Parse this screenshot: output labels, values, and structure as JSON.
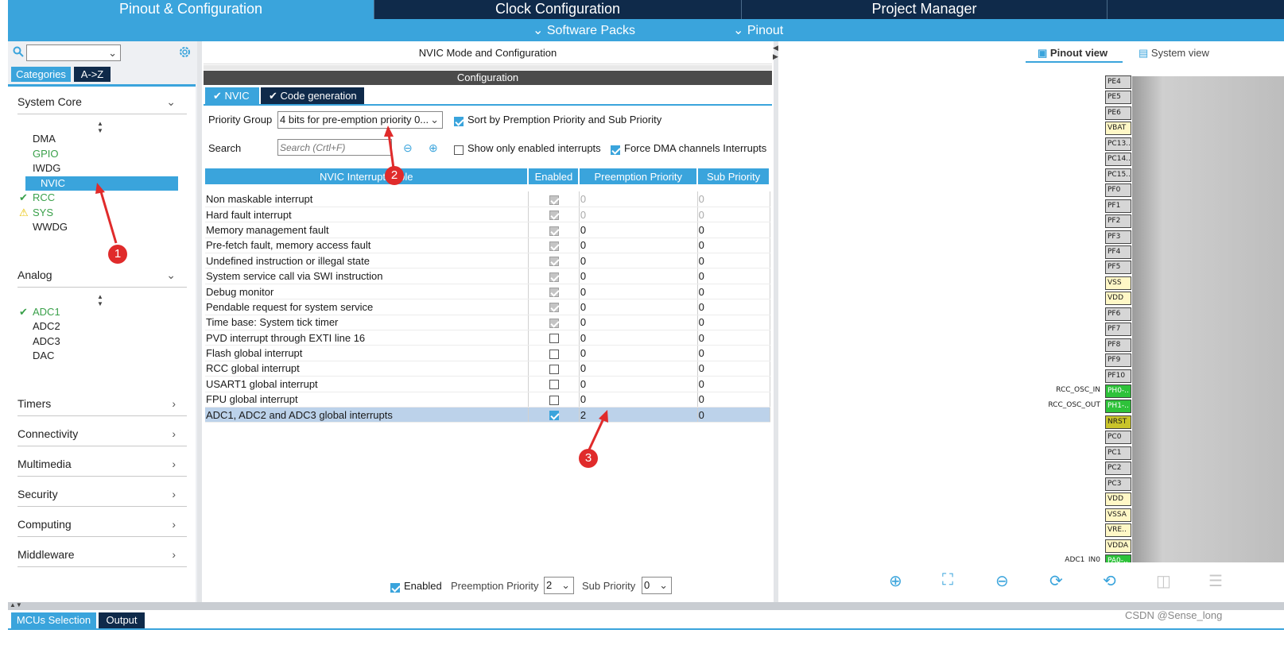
{
  "top_tabs": [
    "Pinout & Configuration",
    "Clock Configuration",
    "Project Manager"
  ],
  "sub_links": [
    "Software Packs",
    "Pinout"
  ],
  "left": {
    "tabs": [
      "Categories",
      "A->Z"
    ],
    "categories": {
      "system_core": "System Core",
      "analog": "Analog",
      "timers": "Timers",
      "connectivity": "Connectivity",
      "multimedia": "Multimedia",
      "security": "Security",
      "computing": "Computing",
      "middleware": "Middleware"
    },
    "system_core_items": [
      "DMA",
      "GPIO",
      "IWDG",
      "NVIC",
      "RCC",
      "SYS",
      "WWDG"
    ],
    "analog_items": [
      "ADC1",
      "ADC2",
      "ADC3",
      "DAC"
    ]
  },
  "center": {
    "title": "NVIC Mode and Configuration",
    "config_label": "Configuration",
    "tabs": [
      "NVIC",
      "Code generation"
    ],
    "priority_group_label": "Priority Group",
    "priority_group_value": "4 bits for pre-emption priority 0...",
    "sort_label": "Sort by Premption Priority and Sub Priority",
    "search_label": "Search",
    "search_placeholder": "Search (Crtl+F)",
    "show_only_label": "Show only enabled interrupts",
    "force_dma_label": "Force DMA channels Interrupts",
    "columns": [
      "NVIC Interrupt Table",
      "Enabled",
      "Preemption Priority",
      "Sub Priority"
    ],
    "rows": [
      {
        "name": "Non maskable interrupt",
        "enabled": "gray",
        "pre": "0",
        "sub": "0",
        "dim": true
      },
      {
        "name": "Hard fault interrupt",
        "enabled": "gray",
        "pre": "0",
        "sub": "0",
        "dim": true
      },
      {
        "name": "Memory management fault",
        "enabled": "gray",
        "pre": "0",
        "sub": "0"
      },
      {
        "name": "Pre-fetch fault, memory access fault",
        "enabled": "gray",
        "pre": "0",
        "sub": "0"
      },
      {
        "name": "Undefined instruction or illegal state",
        "enabled": "gray",
        "pre": "0",
        "sub": "0"
      },
      {
        "name": "System service call via SWI instruction",
        "enabled": "gray",
        "pre": "0",
        "sub": "0"
      },
      {
        "name": "Debug monitor",
        "enabled": "gray",
        "pre": "0",
        "sub": "0"
      },
      {
        "name": "Pendable request for system service",
        "enabled": "gray",
        "pre": "0",
        "sub": "0"
      },
      {
        "name": "Time base: System tick timer",
        "enabled": "gray",
        "pre": "0",
        "sub": "0"
      },
      {
        "name": "PVD interrupt through EXTI line 16",
        "enabled": "off",
        "pre": "0",
        "sub": "0"
      },
      {
        "name": "Flash global interrupt",
        "enabled": "off",
        "pre": "0",
        "sub": "0"
      },
      {
        "name": "RCC global interrupt",
        "enabled": "off",
        "pre": "0",
        "sub": "0"
      },
      {
        "name": "USART1 global interrupt",
        "enabled": "off",
        "pre": "0",
        "sub": "0"
      },
      {
        "name": "FPU global interrupt",
        "enabled": "off",
        "pre": "0",
        "sub": "0"
      },
      {
        "name": "ADC1, ADC2 and ADC3 global interrupts",
        "enabled": "on",
        "pre": "2",
        "sub": "0",
        "highlight": true
      }
    ],
    "bottom": {
      "enabled_label": "Enabled",
      "preemption_label": "Preemption Priority",
      "preemption_value": "2",
      "sub_label": "Sub Priority",
      "sub_value": "0"
    }
  },
  "right": {
    "views": [
      "Pinout view",
      "System view"
    ],
    "pins": [
      {
        "name": "PE4",
        "type": "gray"
      },
      {
        "name": "PE5",
        "type": "gray"
      },
      {
        "name": "PE6",
        "type": "gray"
      },
      {
        "name": "VBAT",
        "type": "yellow"
      },
      {
        "name": "PC13..",
        "type": "gray"
      },
      {
        "name": "PC14..",
        "type": "gray"
      },
      {
        "name": "PC15..",
        "type": "gray"
      },
      {
        "name": "PF0",
        "type": "gray"
      },
      {
        "name": "PF1",
        "type": "gray"
      },
      {
        "name": "PF2",
        "type": "gray"
      },
      {
        "name": "PF3",
        "type": "gray"
      },
      {
        "name": "PF4",
        "type": "gray"
      },
      {
        "name": "PF5",
        "type": "gray"
      },
      {
        "name": "VSS",
        "type": "yellow"
      },
      {
        "name": "VDD",
        "type": "yellow"
      },
      {
        "name": "PF6",
        "type": "gray"
      },
      {
        "name": "PF7",
        "type": "gray"
      },
      {
        "name": "PF8",
        "type": "gray"
      },
      {
        "name": "PF9",
        "type": "gray"
      },
      {
        "name": "PF10",
        "type": "gray"
      },
      {
        "name": "PH0-..",
        "type": "green"
      },
      {
        "name": "PH1-..",
        "type": "green"
      },
      {
        "name": "NRST",
        "type": "olive"
      },
      {
        "name": "PC0",
        "type": "gray"
      },
      {
        "name": "PC1",
        "type": "gray"
      },
      {
        "name": "PC2",
        "type": "gray"
      },
      {
        "name": "PC3",
        "type": "gray"
      },
      {
        "name": "VDD",
        "type": "yellow"
      },
      {
        "name": "VSSA",
        "type": "yellow"
      },
      {
        "name": "VRE..",
        "type": "yellow"
      },
      {
        "name": "VDDA",
        "type": "yellow"
      },
      {
        "name": "PA0-..",
        "type": "green"
      }
    ],
    "pin_labels": {
      "rcc_osc_in": "RCC_OSC_IN",
      "rcc_osc_out": "RCC_OSC_OUT",
      "adc1_in0": "ADC1_IN0"
    }
  },
  "bottom_tabs": [
    "MCUs Selection",
    "Output"
  ],
  "watermark": "CSDN @Sense_long",
  "annotations": [
    "1",
    "2",
    "3"
  ],
  "colors": {
    "accent": "#3aa4dc",
    "navy": "#0f2a4a",
    "annotation": "#e02b2b"
  }
}
